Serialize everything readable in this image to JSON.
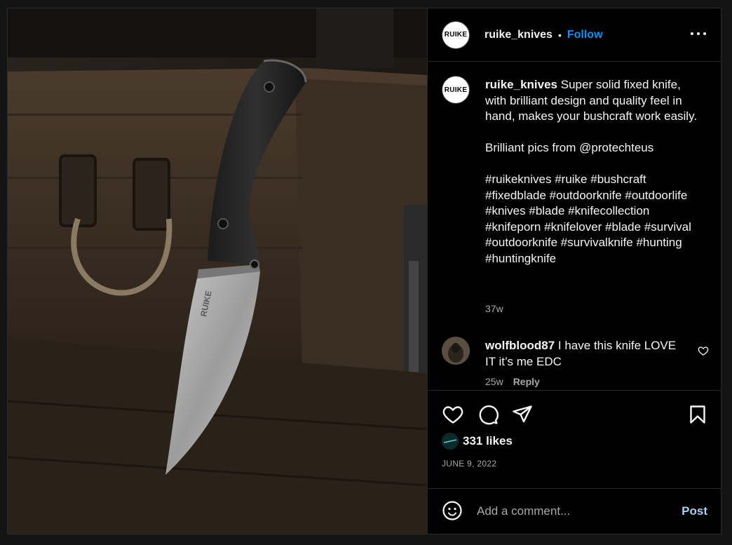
{
  "post": {
    "username": "ruike_knives",
    "avatar_text": "RUIKE",
    "dot": "•",
    "follow_label": "Follow",
    "photo_blade_text": "RUIKE"
  },
  "caption": {
    "username": "ruike_knives",
    "line1": "Super solid fixed knife, with brilliant design and quality feel in hand, makes your bushcraft work easily.",
    "line2": "Brilliant pics from @protechteus",
    "hashtags": "#ruikeknives #ruike #bushcraft #fixedblade #outdoorknife #outdoorlife #knives #blade #knifecollection #knifeporn #knifelover #blade #survival #outdoorknife #survivalknife #hunting #huntingknife",
    "time": "37w"
  },
  "comment": {
    "username": "wolfblood87",
    "text": "I have this knife LOVE IT it’s me EDC",
    "time": "25w",
    "reply_label": "Reply"
  },
  "stats": {
    "likes": "331 likes",
    "date": "JUNE 9, 2022"
  },
  "composer": {
    "placeholder": "Add a comment...",
    "post_label": "Post"
  },
  "colors": {
    "accent": "#0095f6",
    "post_disabled": "#a9cdf4",
    "muted": "#a8a8a8",
    "background": "#000000"
  },
  "icons": [
    "more-options-icon",
    "heart-icon",
    "comment-icon",
    "share-icon",
    "bookmark-icon",
    "emoji-icon",
    "comment-like-icon"
  ]
}
